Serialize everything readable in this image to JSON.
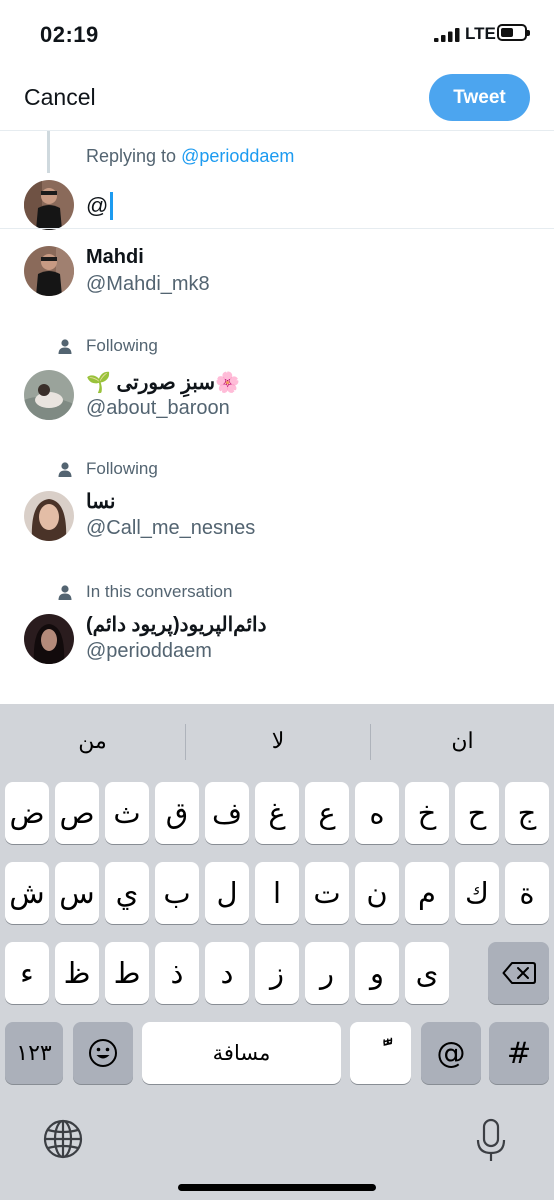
{
  "status_bar": {
    "time": "02:19",
    "network": "LTE"
  },
  "header": {
    "cancel_label": "Cancel",
    "tweet_label": "Tweet"
  },
  "composer": {
    "replying_prefix": "Replying to",
    "replying_handle": "@perioddaem",
    "input_value": "@"
  },
  "suggestions": [
    {
      "context": "",
      "name": "Mahdi",
      "handle": "@Mahdi_mk8"
    },
    {
      "context": "Following",
      "name": "🌱 سبزِ صورتی🌸",
      "handle": "@about_baroon"
    },
    {
      "context": "Following",
      "name": "نسا",
      "handle": "@Call_me_nesnes"
    },
    {
      "context": "In this conversation",
      "name": "دائم‌الپریود(پریود دائم)",
      "handle": "@perioddaem"
    }
  ],
  "keyboard": {
    "predictions": [
      "من",
      "لا",
      "ان"
    ],
    "row1": [
      "ض",
      "ص",
      "ث",
      "ق",
      "ف",
      "غ",
      "ع",
      "ه",
      "خ",
      "ح",
      "ج"
    ],
    "row2": [
      "ش",
      "س",
      "ي",
      "ب",
      "ل",
      "ا",
      "ت",
      "ن",
      "م",
      "ك",
      "ة"
    ],
    "row3": [
      "ء",
      "ظ",
      "ط",
      "ذ",
      "د",
      "ز",
      "ر",
      "و",
      "ى"
    ],
    "numbers_label": "١٢٣",
    "space_label": "مسافة",
    "diacritic_label": "ًّ",
    "at_label": "@",
    "hash_label": "#"
  },
  "icons": [
    "signal-icon",
    "battery-icon",
    "person-icon",
    "emoji-icon",
    "backspace-icon",
    "globe-icon",
    "microphone-icon"
  ],
  "colors": {
    "accent": "#1d9bf0",
    "tweet_button": "#4ca5ef",
    "keyboard_bg": "#d1d4d9"
  }
}
